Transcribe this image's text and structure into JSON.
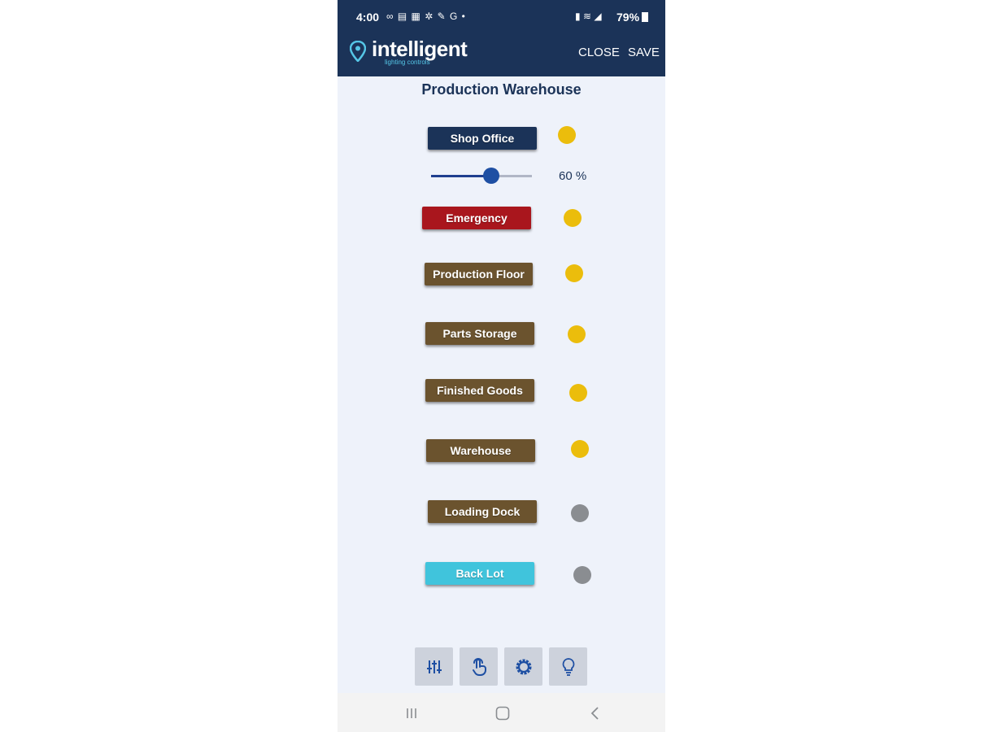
{
  "status_bar": {
    "time": "4:00",
    "left_icons": "∞ ▤ ▦ ✲ ✎ G •",
    "right_icons": "▮ ≋ ◢",
    "battery": "79%"
  },
  "header": {
    "logo_text": "intelligent",
    "logo_sub": "lighting controls",
    "close_label": "CLOSE",
    "save_label": "SAVE",
    "background": "#1b3358"
  },
  "page_title": "Production Warehouse",
  "dimmer": {
    "value_percent": 60,
    "value_label": "60 %"
  },
  "zones": [
    {
      "label": "Shop Office",
      "color": "#1b3358",
      "status": "on"
    },
    {
      "label": "Emergency",
      "color": "#a9161d",
      "status": "on"
    },
    {
      "label": "Production Floor",
      "color": "#6b532e",
      "status": "on"
    },
    {
      "label": "Parts Storage",
      "color": "#6b532e",
      "status": "on"
    },
    {
      "label": "Finished Goods",
      "color": "#6b532e",
      "status": "on"
    },
    {
      "label": "Warehouse",
      "color": "#6b532e",
      "status": "on"
    },
    {
      "label": "Loading Dock",
      "color": "#6b532e",
      "status": "off"
    },
    {
      "label": "Back Lot",
      "color": "#40c4dc",
      "status": "off"
    }
  ],
  "status_colors": {
    "on": "#ebbd0c",
    "off": "#8a8d91"
  },
  "toolbar": [
    "sliders-icon",
    "touch-icon",
    "gear-icon",
    "bulb-icon"
  ],
  "nav": [
    "recent-apps-icon",
    "home-icon",
    "back-icon"
  ]
}
